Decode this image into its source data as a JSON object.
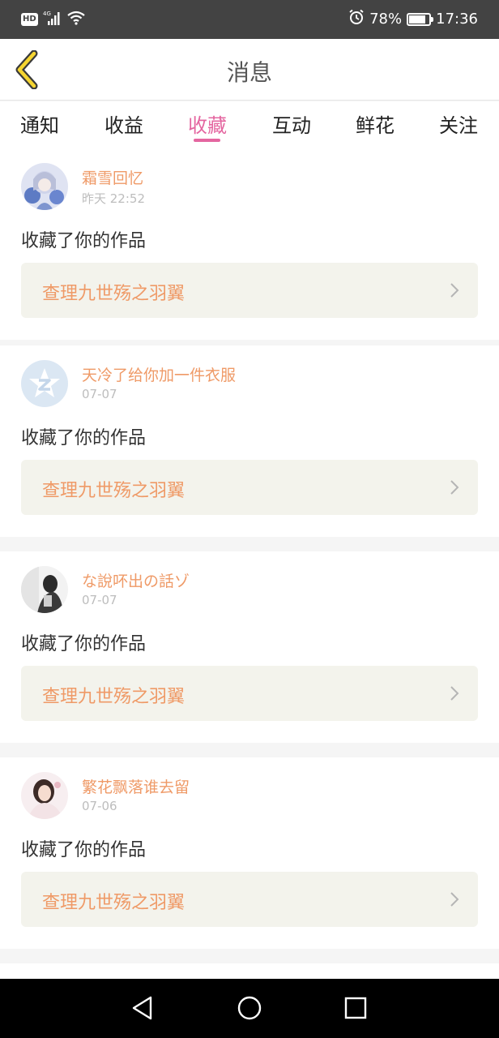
{
  "status_bar": {
    "hd": "HD",
    "network": "4G",
    "battery_percent": "78%",
    "battery_level": 0.78,
    "time": "17:36"
  },
  "nav": {
    "title": "消息",
    "back_icon": "chevron-left-icon"
  },
  "tabs": [
    {
      "label": "通知",
      "active": false
    },
    {
      "label": "收益",
      "active": false
    },
    {
      "label": "收藏",
      "active": true
    },
    {
      "label": "互动",
      "active": false
    },
    {
      "label": "鲜花",
      "active": false
    },
    {
      "label": "关注",
      "active": false
    }
  ],
  "messages": [
    {
      "user": "霜雪回忆",
      "time": "昨天 22:52",
      "action": "收藏了你的作品",
      "work": "查理九世殇之羽翼"
    },
    {
      "user": "天冷了给你加一件衣服",
      "time": "07-07",
      "action": "收藏了你的作品",
      "work": "查理九世殇之羽翼"
    },
    {
      "user": "な說吥出の話ゾ",
      "time": "07-07",
      "action": "收藏了你的作品",
      "work": "查理九世殇之羽翼"
    },
    {
      "user": "繁花飘落谁去留",
      "time": "07-06",
      "action": "收藏了你的作品",
      "work": "查理九世殇之羽翼"
    }
  ],
  "colors": {
    "accent": "#e466a0",
    "name_color": "#ef9a67",
    "status_bar": "#434343"
  },
  "android_nav": [
    "back-triangle-icon",
    "home-circle-icon",
    "recents-square-icon"
  ]
}
